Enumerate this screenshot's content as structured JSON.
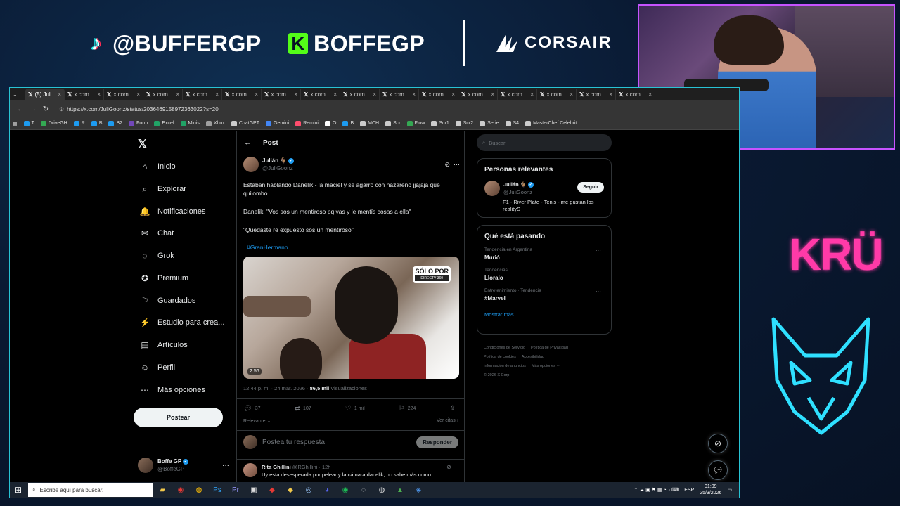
{
  "overlay": {
    "tiktok_handle": "@BUFFERGP",
    "kick_handle": "BOFFEGP",
    "sponsor": "CORSAIR",
    "team_logo": "KRÜ"
  },
  "browser": {
    "tabs": [
      {
        "label": "(5) Juli",
        "icon": "x-icon",
        "close": "×",
        "active": true
      },
      {
        "label": "x.com",
        "icon": "x-icon",
        "close": "×"
      },
      {
        "label": "x.com",
        "icon": "x-icon",
        "close": "×"
      },
      {
        "label": "x.com",
        "icon": "x-icon",
        "close": "×"
      },
      {
        "label": "x.com",
        "icon": "x-icon",
        "close": "×"
      },
      {
        "label": "x.com",
        "icon": "x-icon",
        "close": "×"
      },
      {
        "label": "x.com",
        "icon": "x-icon",
        "close": "×"
      },
      {
        "label": "x.com",
        "icon": "x-icon",
        "close": "×"
      },
      {
        "label": "x.com",
        "icon": "x-icon",
        "close": "×"
      },
      {
        "label": "x.com",
        "icon": "x-icon",
        "close": "×"
      },
      {
        "label": "x.com",
        "icon": "x-icon",
        "close": "×"
      },
      {
        "label": "x.com",
        "icon": "x-icon",
        "close": "×"
      },
      {
        "label": "x.com",
        "icon": "x-icon",
        "close": "×"
      },
      {
        "label": "x.com",
        "icon": "x-icon",
        "close": "×"
      },
      {
        "label": "x.com",
        "icon": "x-icon",
        "close": "×"
      },
      {
        "label": "x.com",
        "icon": "x-icon",
        "close": "×"
      }
    ],
    "url": "https://x.com/JuliGoonz/status/2036469158972363022?s=20",
    "bookmarks": [
      {
        "label": "T",
        "color": "#1d9bf0"
      },
      {
        "label": "DriveGH",
        "color": "#34a853"
      },
      {
        "label": "R",
        "color": "#1d9bf0"
      },
      {
        "label": "B",
        "color": "#1d9bf0"
      },
      {
        "label": "B2",
        "color": "#1d9bf0"
      },
      {
        "label": "Form",
        "color": "#7248b9"
      },
      {
        "label": "Excel",
        "color": "#21a366"
      },
      {
        "label": "Minis",
        "color": "#21a366"
      },
      {
        "label": "Xbox",
        "color": "#9e9e9e"
      },
      {
        "label": "ChatGPT",
        "color": "#cccccc"
      },
      {
        "label": "Gemini",
        "color": "#4285f4"
      },
      {
        "label": "Remini",
        "color": "#ff4d6d"
      },
      {
        "label": "O",
        "color": "#ffffff"
      },
      {
        "label": "B",
        "color": "#1d9bf0"
      },
      {
        "label": "MCH",
        "color": "#cccccc"
      },
      {
        "label": "Scr",
        "color": "#cccccc"
      },
      {
        "label": "Flow",
        "color": "#34a853"
      },
      {
        "label": "Scr1",
        "color": "#cccccc"
      },
      {
        "label": "Scr2",
        "color": "#cccccc"
      },
      {
        "label": "Serie",
        "color": "#cccccc"
      },
      {
        "label": "S4",
        "color": "#cccccc"
      },
      {
        "label": "MasterChef Celebrit...",
        "color": "#cccccc"
      }
    ]
  },
  "nav": {
    "items": [
      {
        "label": "Inicio",
        "icon": "home-icon",
        "glyph": "⌂"
      },
      {
        "label": "Explorar",
        "icon": "search-icon",
        "glyph": "⌕"
      },
      {
        "label": "Notificaciones",
        "icon": "bell-icon",
        "glyph": "🔔"
      },
      {
        "label": "Chat",
        "icon": "mail-icon",
        "glyph": "✉"
      },
      {
        "label": "Grok",
        "icon": "grok-icon",
        "glyph": "◌"
      },
      {
        "label": "Premium",
        "icon": "premium-icon",
        "glyph": "✪"
      },
      {
        "label": "Guardados",
        "icon": "bookmark-icon",
        "glyph": "⚐"
      },
      {
        "label": "Estudio para crea...",
        "icon": "studio-icon",
        "glyph": "⚡"
      },
      {
        "label": "Artículos",
        "icon": "articles-icon",
        "glyph": "▤"
      },
      {
        "label": "Perfil",
        "icon": "profile-icon",
        "glyph": "☺"
      },
      {
        "label": "Más opciones",
        "icon": "more-icon",
        "glyph": "⋯"
      }
    ],
    "post_button": "Postear",
    "account": {
      "name": "Boffe GP",
      "handle": "@BoffeGP"
    }
  },
  "post": {
    "header": "Post",
    "author": {
      "name": "Julián 🐐",
      "handle": "@JuliGoonz"
    },
    "paragraphs": [
      "Estaban hablando Danelik - la maciel y se agarro con nazareno jjajaja que quilombo",
      "Danelik: \"Vos sos un mentiroso pq vas y le mentís cosas a ella\"",
      "\"Quedaste re expuesto sos un mentiroso\""
    ],
    "hashtag": "#GranHermano",
    "media": {
      "badge": "SÓLO POR",
      "badge_sub": "DIRECTV 360",
      "duration": "2:56"
    },
    "time": "12:44 p. m. · 24 mar. 2026 · ",
    "views_count": "86,5 mil",
    "views_label": " Visualizaciones",
    "actions": {
      "replies": "37",
      "reposts": "107",
      "likes": "1 mil",
      "bookmarks": "224"
    },
    "sort": "Relevante",
    "quotes": "Ver citas"
  },
  "reply": {
    "placeholder": "Postea tu respuesta",
    "button": "Responder"
  },
  "reply_tweet": {
    "name": "Rita Ghillini",
    "handle": "@RGhillini · 12h",
    "text": "Uy esta desesperada por pelear y la cámara danelik, no sabe más como"
  },
  "sidebar": {
    "search_placeholder": "Buscar",
    "relevant_title": "Personas relevantes",
    "person": {
      "name": "Julián 🐐",
      "handle": "@JuliGoonz",
      "follow": "Seguir",
      "bio": "F1 - River Plate - Tenis - me gustan los realityS"
    },
    "trending_title": "Qué está pasando",
    "trends": [
      {
        "category": "Tendencia en Argentina",
        "name": "Murió"
      },
      {
        "category": "Tendencias",
        "name": "Lloralo"
      },
      {
        "category": "Entretenimiento · Tendencia",
        "name": "#Marvel"
      }
    ],
    "show_more": "Mostrar más",
    "footer": [
      "Condiciones de Servicio",
      "Política de Privacidad",
      "Política de cookies",
      "Accesibilidad",
      "Información de anuncios",
      "Más opciones ···",
      "© 2026 X Corp."
    ]
  },
  "taskbar": {
    "search": "Escribe aquí para buscar.",
    "lang": "ESP",
    "time": "01:09",
    "date": "25/3/2026"
  },
  "colors": {
    "accent": "#1d9bf0",
    "browser_border": "#28c3d4",
    "webcam_border": "#c653ff",
    "kru_pink": "#ff3aa8",
    "wolf_cyan": "#2fe0ff"
  }
}
